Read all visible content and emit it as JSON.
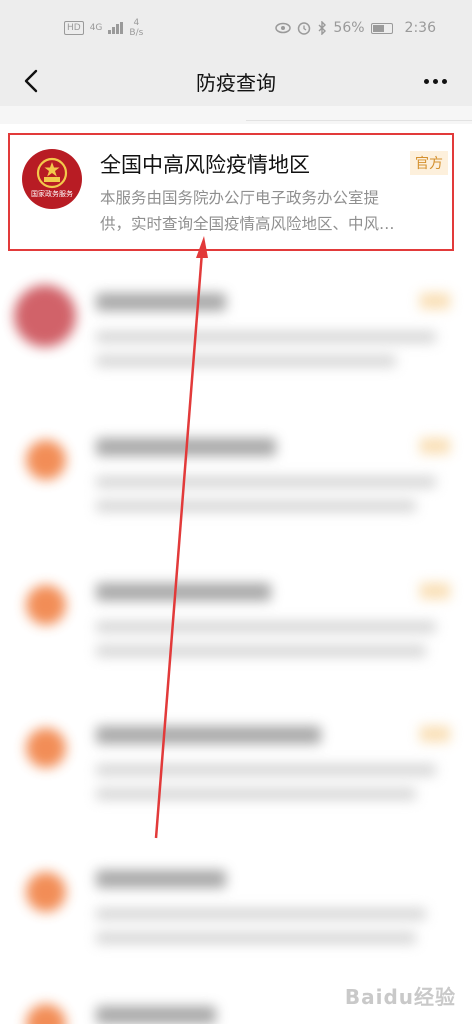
{
  "status_bar": {
    "hd": "HD",
    "network": "4G",
    "speed_value": "4",
    "speed_unit": "B/s",
    "battery": "56%",
    "time": "2:36"
  },
  "nav": {
    "title": "防疫查询"
  },
  "result": {
    "title": "全国中高风险疫情地区",
    "badge": "官方",
    "emblem_text": "国家政务服务",
    "description_lines": [
      "本服务由国务院办公厅电子政务办公室提",
      "供，实时查询全国疫情高风险地区、中风…"
    ]
  },
  "watermark": "Baidu经验",
  "colors": {
    "header_bg": "#ededed",
    "highlight_border": "#e23a3a",
    "badge_text": "#d4902e",
    "badge_bg": "#fdf0dc",
    "emblem_bg": "#b81c24"
  }
}
